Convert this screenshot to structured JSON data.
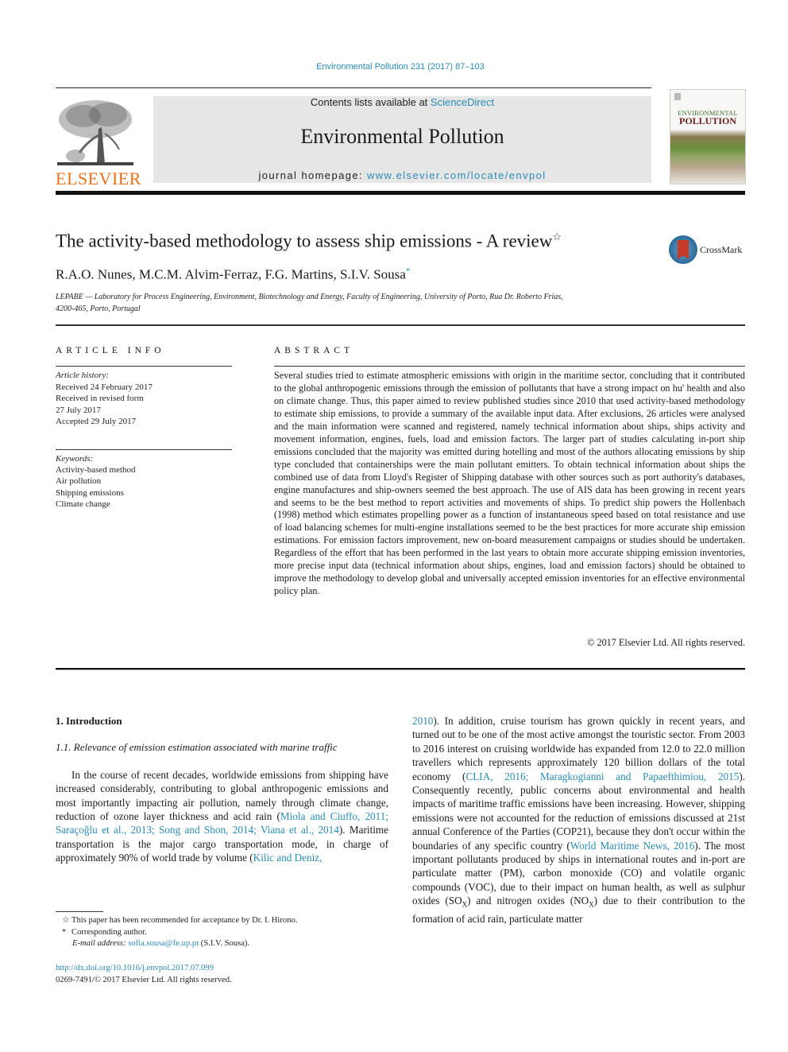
{
  "journal_ref": "Environmental Pollution 231 (2017) 87–103",
  "header": {
    "publisher_logo_text": "ELSEVIER",
    "contents_prefix": "Contents lists available at ",
    "contents_link": "ScienceDirect",
    "journal_title": "Environmental Pollution",
    "homepage_prefix": "journal homepage: ",
    "homepage_link": "www.elsevier.com/locate/envpol",
    "cover_title_line1": "ENVIRONMENTAL",
    "cover_title_line2": "POLLUTION"
  },
  "article": {
    "title": "The activity-based methodology to assess ship emissions - A review",
    "title_mark": "☆",
    "crossmark_label": "CrossMark",
    "authors": "R.A.O. Nunes, M.C.M. Alvim-Ferraz, F.G. Martins, S.I.V. Sousa",
    "author_mark": "*",
    "affiliation_line1": "LEPABE — Laboratory for Process Engineering, Environment, Biotechnology and Energy, Faculty of Engineering, University of Porto, Rua Dr. Roberto Frias,",
    "affiliation_line2": "4200-465, Porto, Portugal"
  },
  "article_info": {
    "heading": "ARTICLE INFO",
    "history_label": "Article history:",
    "history": [
      "Received 24 February 2017",
      "Received in revised form",
      "27 July 2017",
      "Accepted 29 July 2017"
    ],
    "keywords_label": "Keywords:",
    "keywords": [
      "Activity-based method",
      "Air pollution",
      "Shipping emissions",
      "Climate change"
    ]
  },
  "abstract": {
    "heading": "ABSTRACT",
    "text": "Several studies tried to estimate atmospheric emissions with origin in the maritime sector, concluding that it contributed to the global anthropogenic emissions through the emission of pollutants that have a strong impact on hu' health and also on climate change. Thus, this paper aimed to review published studies since 2010 that used activity-based methodology to estimate ship emissions, to provide a summary of the available input data. After exclusions, 26 articles were analysed and the main information were scanned and registered, namely technical information about ships, ships activity and movement information, engines, fuels, load and emission factors. The larger part of studies calculating in-port ship emissions concluded that the majority was emitted during hotelling and most of the authors allocating emissions by ship type concluded that containerships were the main pollutant emitters. To obtain technical information about ships the combined use of data from Lloyd's Register of Shipping database with other sources such as port authority's databases, engine manufactures and ship-owners seemed the best approach. The use of AIS data has been growing in recent years and seems to be the best method to report activities and movements of ships. To predict ship powers the Hollenbach (1998) method which estimates propelling power as a function of instantaneous speed based on total resistance and use of load balancing schemes for multi-engine installations seemed to be the best practices for more accurate ship emission estimations. For emission factors improvement, new on-board measurement campaigns or studies should be undertaken. Regardless of the effort that has been performed in the last years to obtain more accurate shipping emission inventories, more precise input data (technical information about ships, engines, load and emission factors) should be obtained to improve the methodology to develop global and universally accepted emission inventories for an effective environmental policy plan.",
    "copyright": "© 2017 Elsevier Ltd. All rights reserved."
  },
  "body": {
    "section_heading": "1.  Introduction",
    "subsection_heading": "1.1.  Relevance of emission estimation associated with marine traffic",
    "left": {
      "p1_a": "In the course of recent decades, worldwide emissions from shipping have increased considerably, contributing to global anthropogenic emissions and most importantly impacting air pollution, namely through climate change, reduction of ozone layer thickness and acid rain (",
      "cite1": "Miola and Ciuffo, 2011; Saraçoğlu et al., 2013; Song and Shon, 2014; Viana et al., 2014",
      "p1_b": "). Maritime transportation is the major cargo transportation mode, in charge of approximately 90% of world trade by volume (",
      "cite2": "Kilic and Deniz,"
    },
    "right": {
      "cite2_end": "2010",
      "p_a": "). In addition, cruise tourism has grown quickly in recent years, and turned out to be one of the most active amongst the touristic sector. From 2003 to 2016 interest on cruising worldwide has expanded from 12.0 to 22.0 million travellers which represents approximately 120 billion dollars of the total economy (",
      "cite3": "CLIA, 2016; Maragkogianni and Papaefthimiou, 2015",
      "p_b": "). Consequently recently, public concerns about environmental and health impacts of maritime traffic emissions have been increasing. However, shipping emissions were not accounted for the reduction of emissions discussed at 21st annual Conference of the Parties (COP21), because they don't occur within the boundaries of any specific country (",
      "cite4": "World Maritime News, 2016",
      "p_c": "). The most important pollutants produced by ships in international routes and in-port are particulate matter (PM), carbon monoxide (CO) and volatile organic compounds (VOC), due to their impact on human health, as well as sulphur oxides (SO",
      "sub_x1": "X",
      "p_d": ") and nitrogen oxides (NO",
      "sub_x2": "X",
      "p_e": ") due to their contribution to the formation of acid rain, particulate matter"
    }
  },
  "footnotes": {
    "fn1_mark": "☆",
    "fn1": "This paper has been recommended for acceptance by Dr. I. Hirono.",
    "fn2_mark": "*",
    "fn2": "Corresponding author.",
    "email_label": "E-mail address: ",
    "email": "sofia.sousa@fe.up.pt",
    "email_suffix": " (S.I.V. Sousa).",
    "doi": "http://dx.doi.org/10.1016/j.envpol.2017.07.099",
    "issn": "0269-7491/© 2017 Elsevier Ltd. All rights reserved."
  }
}
